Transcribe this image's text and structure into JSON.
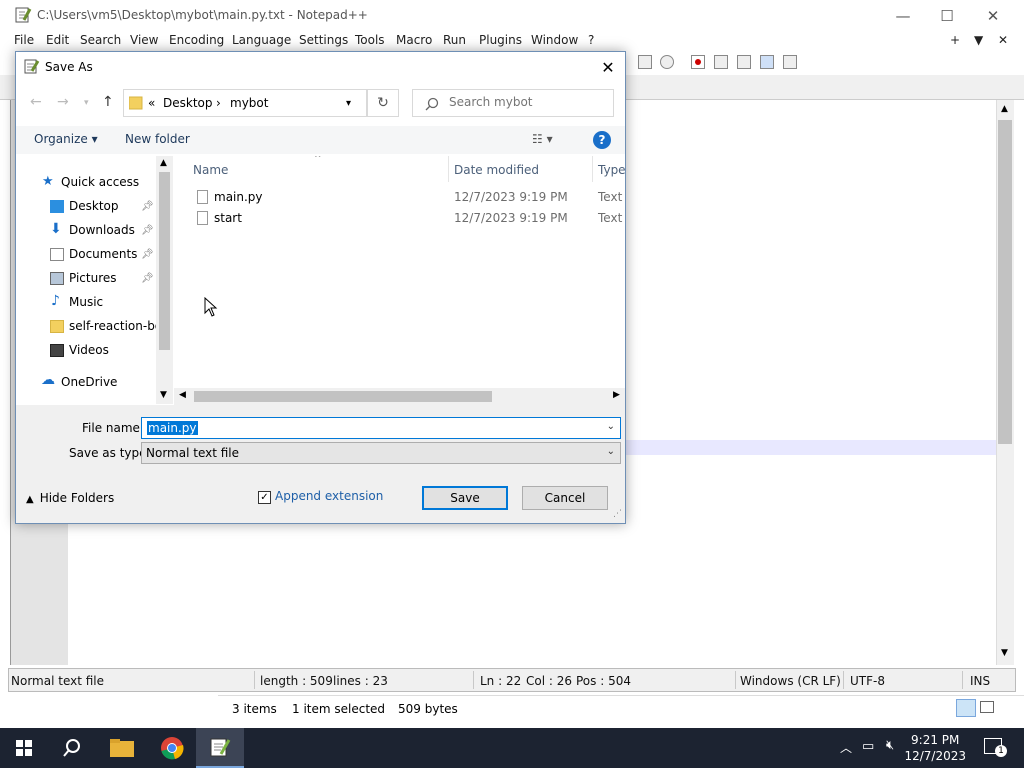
{
  "npp": {
    "title": "C:\\Users\\vm5\\Desktop\\mybot\\main.py.txt - Notepad++",
    "menu": [
      "File",
      "Edit",
      "Search",
      "View",
      "Encoding",
      "Language",
      "Settings",
      "Tools",
      "Macro",
      "Run",
      "Plugins",
      "Window",
      "?"
    ],
    "status": {
      "type": "Normal text file",
      "length": "length : 509",
      "lines": "lines : 23",
      "ln": "Ln : 22",
      "col": "Col : 26",
      "pos": "Pos : 504",
      "eol": "Windows (CR LF)",
      "encoding": "UTF-8",
      "mode": "INS"
    }
  },
  "explorer_status": {
    "items": "3 items",
    "selected": "1 item selected",
    "size": "509 bytes"
  },
  "dialog": {
    "title": "Save As",
    "breadcrumb": {
      "prefix": "«",
      "part1": "Desktop",
      "sep": "›",
      "part2": "mybot"
    },
    "search_placeholder": "Search mybot",
    "organize": "Organize ▾",
    "new_folder": "New folder",
    "help": "?",
    "nav": [
      {
        "label": "Quick access"
      },
      {
        "label": "Desktop"
      },
      {
        "label": "Downloads"
      },
      {
        "label": "Documents"
      },
      {
        "label": "Pictures"
      },
      {
        "label": "Music"
      },
      {
        "label": "self-reaction-bo"
      },
      {
        "label": "Videos"
      },
      {
        "label": "OneDrive"
      }
    ],
    "columns": {
      "name": "Name",
      "date": "Date modified",
      "type": "Type"
    },
    "files": [
      {
        "name": "main.py",
        "date": "12/7/2023 9:19 PM",
        "type": "Text D"
      },
      {
        "name": "start",
        "date": "12/7/2023 9:19 PM",
        "type": "Text D"
      }
    ],
    "file_name_label": "File name:",
    "file_name_value": "main.py",
    "save_type_label": "Save as type:",
    "save_type_value": "Normal text file",
    "hide_folders": "Hide Folders",
    "append_extension": "Append extension",
    "save": "Save",
    "cancel": "Cancel"
  },
  "taskbar": {
    "time": "9:21 PM",
    "date": "12/7/2023",
    "notifications": "1"
  },
  "colors": {
    "accent": "#0078d7",
    "taskbar": "#1c2331"
  }
}
